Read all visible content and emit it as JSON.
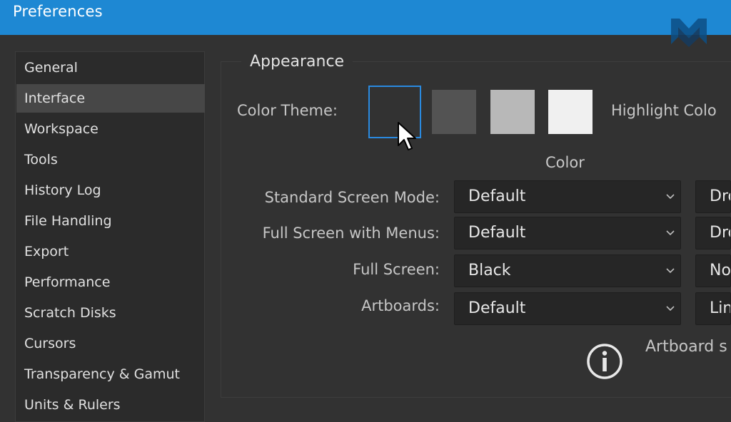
{
  "window": {
    "title": "Preferences"
  },
  "sidebar": {
    "items": [
      {
        "label": "General"
      },
      {
        "label": "Interface"
      },
      {
        "label": "Workspace"
      },
      {
        "label": "Tools"
      },
      {
        "label": "History Log"
      },
      {
        "label": "File Handling"
      },
      {
        "label": "Export"
      },
      {
        "label": "Performance"
      },
      {
        "label": "Scratch Disks"
      },
      {
        "label": "Cursors"
      },
      {
        "label": "Transparency & Gamut"
      },
      {
        "label": "Units & Rulers"
      }
    ],
    "selected": "Interface"
  },
  "appearance": {
    "legend": "Appearance",
    "color_theme_label": "Color Theme:",
    "themes": [
      {
        "name": "darkest",
        "color": "#323232",
        "selected": true
      },
      {
        "name": "dark",
        "color": "#535353",
        "selected": false
      },
      {
        "name": "medium",
        "color": "#b8b8b8",
        "selected": false
      },
      {
        "name": "light",
        "color": "#f0f0f0",
        "selected": false
      }
    ],
    "highlight_label": "Highlight Colo",
    "color_header": "Color",
    "rows": [
      {
        "label": "Standard Screen Mode:",
        "color_value": "Default",
        "border_value": "Dro"
      },
      {
        "label": "Full Screen with Menus:",
        "color_value": "Default",
        "border_value": "Dro"
      },
      {
        "label": "Full Screen:",
        "color_value": "Black",
        "border_value": "No"
      },
      {
        "label": "Artboards:",
        "color_value": "Default",
        "border_value": "Lin"
      }
    ],
    "info_text": "Artboard s"
  },
  "colors": {
    "titlebar": "#1e88d3",
    "accent": "#2a8ae0",
    "background": "#323232"
  },
  "icons": {
    "logo": "mm-logo-icon",
    "info": "info-icon",
    "cursor": "mouse-pointer-icon",
    "dropdown": "chevron-down-icon"
  }
}
